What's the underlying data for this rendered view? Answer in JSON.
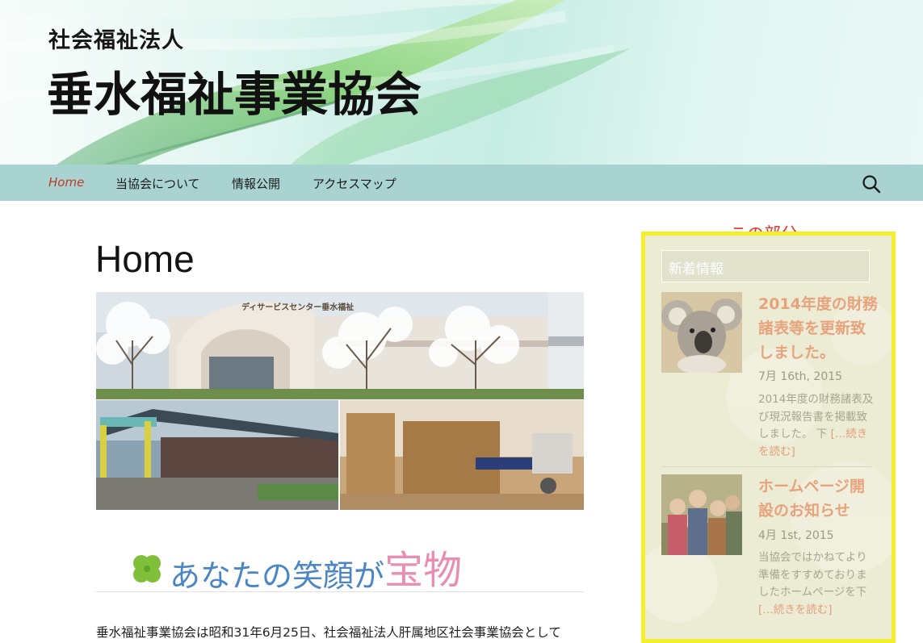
{
  "header": {
    "subtitle": "社会福祉法人",
    "title": "垂水福祉事業協会"
  },
  "nav": {
    "items": [
      {
        "label": "Home",
        "active": true
      },
      {
        "label": "当協会について"
      },
      {
        "label": "情報公開"
      },
      {
        "label": "アクセスマップ"
      }
    ],
    "search_icon": "search-icon"
  },
  "main": {
    "page_title": "Home",
    "hero_sign": "ディサービスセンター垂水福祉",
    "tagline_part1": "あなたの笑顔が",
    "tagline_part2": "宝物",
    "body_text": "垂水福祉事業協会は昭和31年6月25日、社会福祉法人肝属地区社会事業協会として"
  },
  "sidebar": {
    "annotation": "この部分",
    "widget_title": "新着情報",
    "posts": [
      {
        "title": "2014年度の財務諸表等を更新致しました。",
        "date": "7月 16th, 2015",
        "excerpt": "2014年度の財務諸表及び現況報告書を掲載致しました。 下 ",
        "more": "[…続きを読む]"
      },
      {
        "title": "ホームページ開設のお知らせ",
        "date": "4月 1st, 2015",
        "excerpt": "当協会ではかねてより準備をすすめておりましたホームページを下 ",
        "more": " […続きを読む]"
      }
    ]
  },
  "colors": {
    "nav_bg": "#a8d3d0",
    "active_nav": "#c0392b",
    "highlight_border": "#f4ef2a",
    "annotation": "#e8352e",
    "post_title": "#e6a37c",
    "tagline_blue": "#4a86c4",
    "tagline_pink": "#e88db3"
  }
}
